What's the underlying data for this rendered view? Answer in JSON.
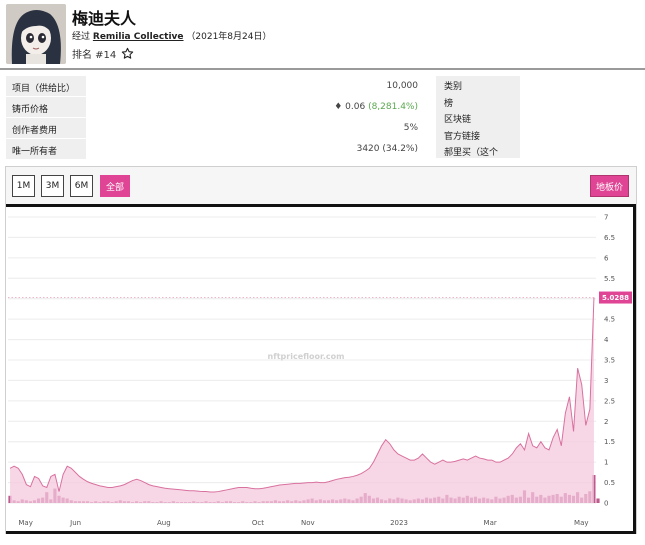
{
  "collection": {
    "name": "梅迪夫人",
    "byline_prefix": "经过",
    "creator": "Remilia Collective",
    "created": "（2021年8月24日）",
    "rank": "排名 #14"
  },
  "stats": [
    {
      "label": "项目（供给比）",
      "value": "10,000",
      "extra": ""
    },
    {
      "label": "铸币价格",
      "value": "♦ 0.06",
      "extra": "(8,281.4%)"
    },
    {
      "label": "创作者费用",
      "value": "5%",
      "extra": ""
    },
    {
      "label": "唯一所有者",
      "value": "3420 (34.2%)",
      "extra": ""
    }
  ],
  "side_items": [
    "类别",
    "榜",
    "区块链",
    "官方链接",
    "郝里买（这个"
  ],
  "ranges": [
    "1M",
    "3M",
    "6M",
    "全部"
  ],
  "active_range": "全部",
  "floor_button": "地板价",
  "chart_data": {
    "type": "area",
    "watermark": "nftpricefloor.com",
    "y_ticks": [
      "7",
      "6.5",
      "6",
      "5.5",
      "5",
      "4.5",
      "4",
      "3.5",
      "3",
      "2.5",
      "2",
      "1.5",
      "1",
      "0.5",
      "0"
    ],
    "y_range": [
      0,
      7
    ],
    "x_ticks": [
      "May",
      "Jun",
      "Aug",
      "Oct",
      "Nov",
      "2023",
      "Mar",
      "May"
    ],
    "current_value": "5.0288",
    "series": [
      {
        "values": [
          0.85,
          0.9,
          0.85,
          0.7,
          0.45,
          0.4,
          0.65,
          0.6,
          0.42,
          0.38,
          0.65,
          0.7,
          0.28,
          0.7,
          0.9,
          0.85,
          0.75,
          0.65,
          0.58,
          0.52,
          0.48,
          0.45,
          0.42,
          0.4,
          0.38,
          0.38,
          0.4,
          0.42,
          0.45,
          0.5,
          0.55,
          0.58,
          0.55,
          0.5,
          0.45,
          0.42,
          0.4,
          0.38,
          0.36,
          0.35,
          0.34,
          0.33,
          0.32,
          0.31,
          0.3,
          0.3,
          0.29,
          0.28,
          0.28,
          0.27,
          0.27,
          0.28,
          0.3,
          0.32,
          0.34,
          0.36,
          0.38,
          0.38,
          0.38,
          0.36,
          0.35,
          0.35,
          0.36,
          0.38,
          0.4,
          0.42,
          0.44,
          0.45,
          0.46,
          0.47,
          0.48,
          0.48,
          0.49,
          0.5,
          0.5,
          0.51,
          0.5,
          0.5,
          0.52,
          0.55,
          0.58,
          0.6,
          0.62,
          0.63,
          0.65,
          0.68,
          0.72,
          0.78,
          0.85,
          1.0,
          1.2,
          1.4,
          1.55,
          1.45,
          1.3,
          1.2,
          1.15,
          1.1,
          1.05,
          1.05,
          1.1,
          1.2,
          1.1,
          1.0,
          0.95,
          1.0,
          1.05,
          1.0,
          1.0,
          1.02,
          1.05,
          1.08,
          1.05,
          1.1,
          1.15,
          1.1,
          1.08,
          1.05,
          1.05,
          1.0,
          1.0,
          1.05,
          1.1,
          1.2,
          1.35,
          1.45,
          1.3,
          1.7,
          1.4,
          1.35,
          1.5,
          1.35,
          1.3,
          1.6,
          1.8,
          1.4,
          2.2,
          2.6,
          1.75,
          3.3,
          2.9,
          1.9,
          2.3,
          5.0288
        ]
      }
    ],
    "volume": [
      0.8,
      0.3,
      0.2,
      0.4,
      0.3,
      0.2,
      0.3,
      0.5,
      0.6,
      1.2,
      0.4,
      1.6,
      0.8,
      0.6,
      0.5,
      0.3,
      0.2,
      0.2,
      0.2,
      0.2,
      0.1,
      0.2,
      0.1,
      0.2,
      0.2,
      0.1,
      0.2,
      0.3,
      0.2,
      0.2,
      0.1,
      0.2,
      0.1,
      0.2,
      0.2,
      0.1,
      0.1,
      0.2,
      0.1,
      0.1,
      0.2,
      0.1,
      0.1,
      0.1,
      0.1,
      0.2,
      0.1,
      0.1,
      0.2,
      0.1,
      0.1,
      0.2,
      0.1,
      0.2,
      0.2,
      0.1,
      0.1,
      0.2,
      0.1,
      0.1,
      0.2,
      0.1,
      0.2,
      0.2,
      0.2,
      0.3,
      0.2,
      0.2,
      0.3,
      0.2,
      0.3,
      0.2,
      0.3,
      0.4,
      0.5,
      0.3,
      0.4,
      0.3,
      0.3,
      0.4,
      0.3,
      0.4,
      0.5,
      0.4,
      0.3,
      0.5,
      0.7,
      1.1,
      0.8,
      0.5,
      0.6,
      0.4,
      0.3,
      0.5,
      0.4,
      0.6,
      0.5,
      0.4,
      0.3,
      0.4,
      0.5,
      0.4,
      0.6,
      0.5,
      0.6,
      0.7,
      0.5,
      0.9,
      0.6,
      0.5,
      0.7,
      0.6,
      0.8,
      0.6,
      0.7,
      0.5,
      0.6,
      0.5,
      0.4,
      0.7,
      0.5,
      0.6,
      0.8,
      0.9,
      0.6,
      0.7,
      1.4,
      0.6,
      1.2,
      0.7,
      0.9,
      0.6,
      0.8,
      0.9,
      1.0,
      0.7,
      1.1,
      0.9,
      0.8,
      1.2,
      0.6,
      1.0,
      1.3,
      3.1,
      0.5
    ]
  }
}
